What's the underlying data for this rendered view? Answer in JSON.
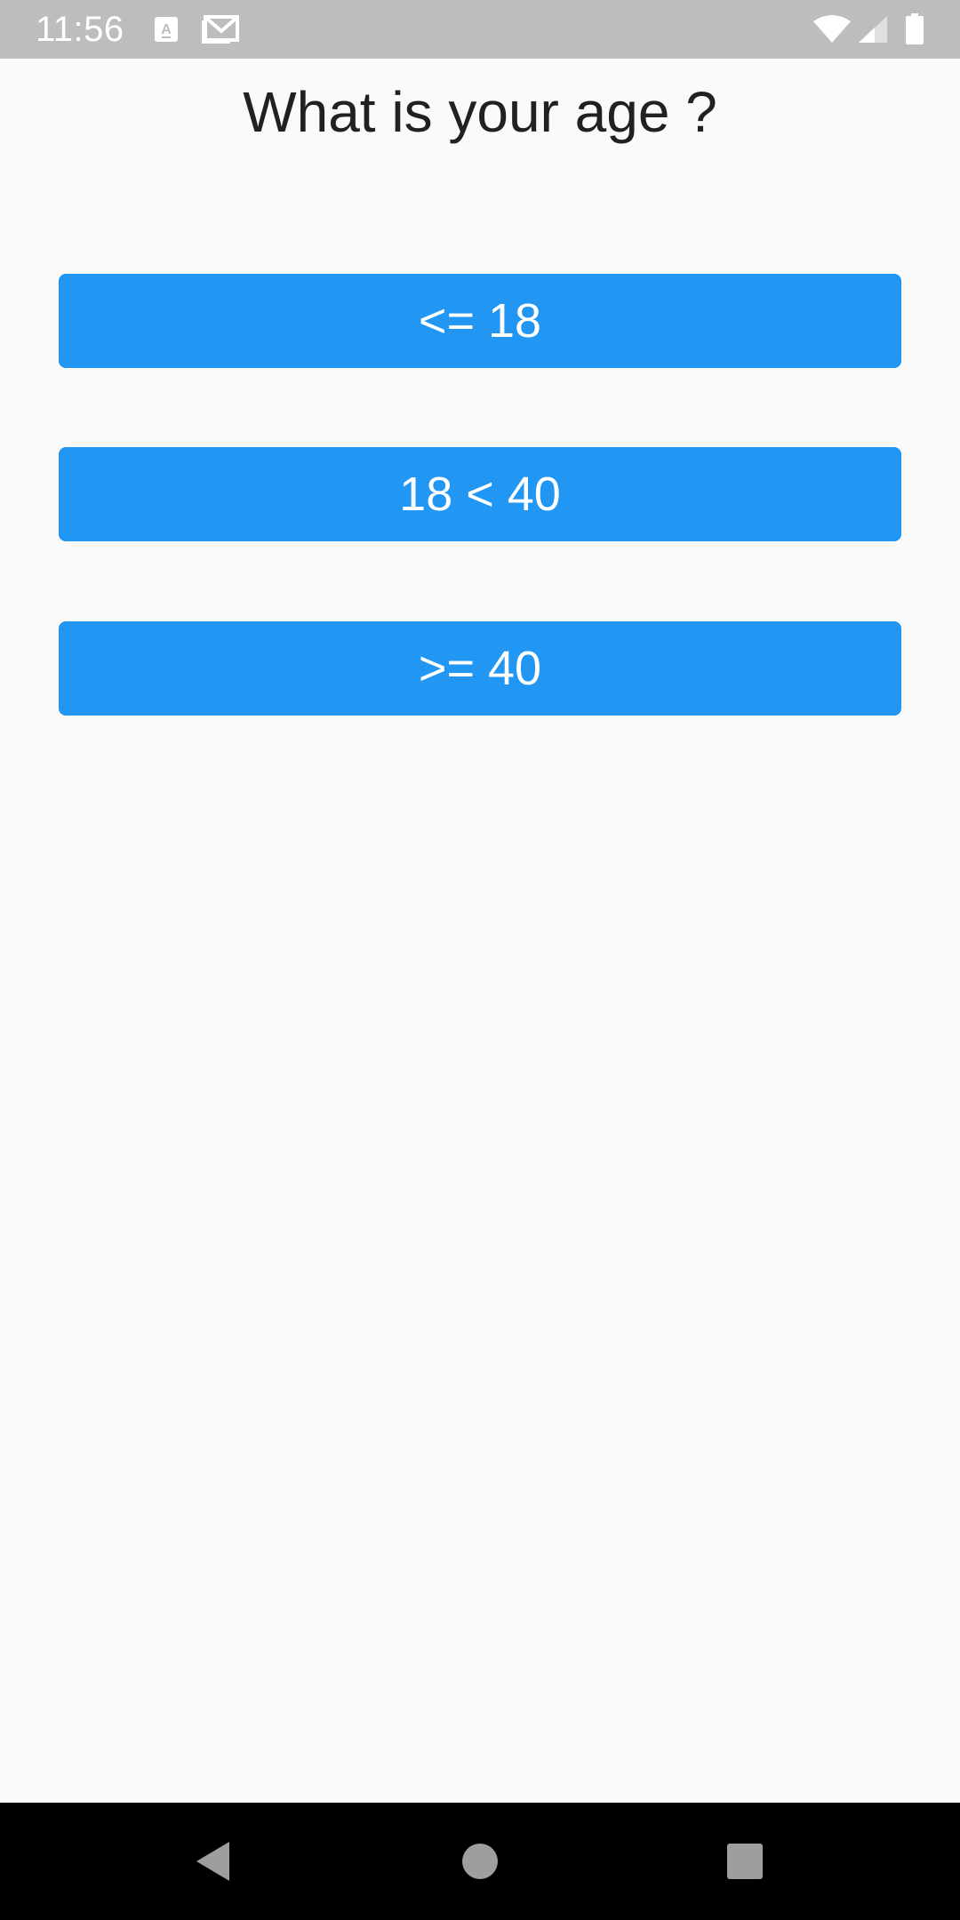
{
  "status_bar": {
    "time": "11:56",
    "notification_icons": [
      "text-a-icon",
      "gmail-icon"
    ],
    "system_icons": [
      "wifi-icon",
      "cellular-signal-icon",
      "battery-icon"
    ]
  },
  "question": {
    "title": "What is your age ?"
  },
  "options": [
    {
      "label": "<= 18"
    },
    {
      "label": "18 < 40"
    },
    {
      "label": ">= 40"
    }
  ],
  "colors": {
    "accent": "#2196f3",
    "status_bar": "#bdbdbd",
    "background": "#fafafa",
    "nav_bar": "#000000"
  },
  "nav_bar": {
    "buttons": [
      "back-icon",
      "home-icon",
      "recents-icon"
    ]
  }
}
